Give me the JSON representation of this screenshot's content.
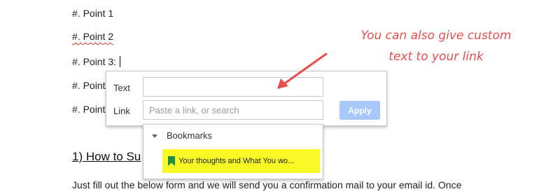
{
  "document": {
    "lines": [
      "#. Point 1",
      "#. Point 2",
      "#. Point 3:",
      "#. Point",
      "#. Point"
    ],
    "heading": "1) How to Su",
    "body_text": "Just fill out the below form and we will send you a confirmation mail to your email id. Once"
  },
  "link_dialog": {
    "text_label": "Text",
    "text_value": "",
    "link_label": "Link",
    "link_placeholder": "Paste a link, or search",
    "apply_label": "Apply",
    "bookmarks_heading": "Bookmarks",
    "bookmark_item": "Your thoughts and What You wo...",
    "highlight_color": "#f8f825"
  },
  "annotation": {
    "line1": "You can also give custom",
    "line2": "text to your link",
    "color": "#e84c4c"
  }
}
